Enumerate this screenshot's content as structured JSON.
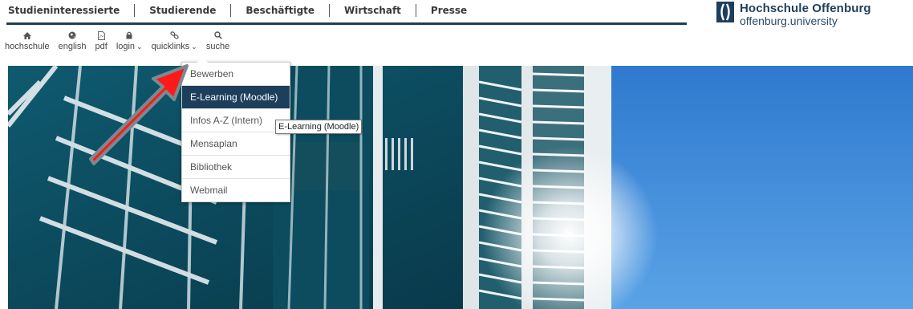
{
  "topnav": {
    "items": [
      {
        "label": "Studieninteressierte"
      },
      {
        "label": "Studierende"
      },
      {
        "label": "Beschäftigte"
      },
      {
        "label": "Wirtschaft"
      },
      {
        "label": "Presse"
      }
    ]
  },
  "logo": {
    "name": "Hochschule Offenburg",
    "domain": "offenburg.university"
  },
  "toolbar": {
    "items": [
      {
        "label": "hochschule",
        "icon": "home-icon"
      },
      {
        "label": "english",
        "icon": "globe-icon"
      },
      {
        "label": "pdf",
        "icon": "pdf-file-icon"
      },
      {
        "label": "login",
        "icon": "lock-icon"
      },
      {
        "label": "quicklinks",
        "icon": "link-icon"
      },
      {
        "label": "suche",
        "icon": "search-icon"
      }
    ]
  },
  "quicklinks_menu": {
    "items": [
      {
        "label": "Bewerben"
      },
      {
        "label": "E-Learning (Moodle)",
        "active": true
      },
      {
        "label": "Infos A-Z (Intern)"
      },
      {
        "label": "Mensaplan"
      },
      {
        "label": "Bibliothek"
      },
      {
        "label": "Webmail"
      }
    ]
  },
  "tooltip": {
    "text": "E-Learning (Moodle)"
  },
  "colors": {
    "brand": "#1d3f5c",
    "annotation_arrow": "#ff1a1a"
  }
}
